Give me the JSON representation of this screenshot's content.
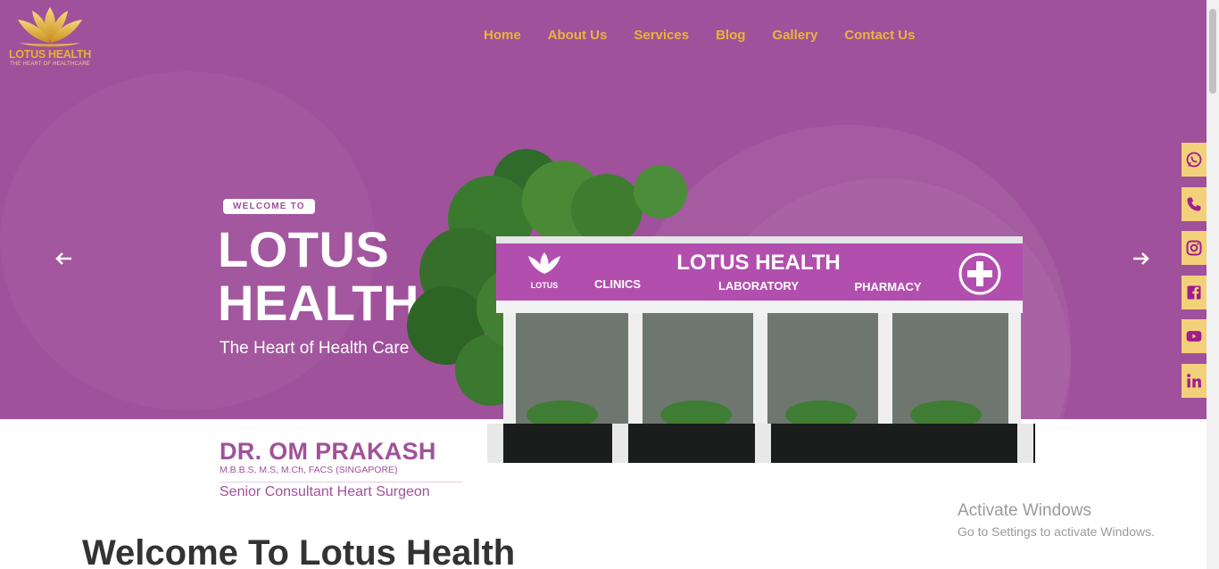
{
  "header": {
    "logo": {
      "brand": "LOTUS HEALTH",
      "tagline": "THE HEART OF HEALTHCARE"
    },
    "nav": [
      {
        "label": "Home"
      },
      {
        "label": "About Us"
      },
      {
        "label": "Services"
      },
      {
        "label": "Blog"
      },
      {
        "label": "Gallery"
      },
      {
        "label": "Contact Us"
      }
    ]
  },
  "hero": {
    "badge": "WELCOME TO",
    "title_line1": "LOTUS",
    "title_line2": "HEALTH",
    "subtitle": "The Heart of Health Care",
    "prev_icon": "arrow-left-icon",
    "next_icon": "arrow-right-icon",
    "building_sign": {
      "name": "LOTUS HEALTH",
      "logo_text": "LOTUS",
      "clinics": "CLINICS",
      "laboratory": "LABORATORY",
      "pharmacy": "PHARMACY"
    }
  },
  "doctor": {
    "name": "DR. OM PRAKASH",
    "qualifications": "M.B.B.S, M.S, M.Ch, FACS (SINGAPORE)",
    "role": "Senior Consultant Heart Surgeon"
  },
  "social": [
    {
      "icon": "whatsapp-icon"
    },
    {
      "icon": "phone-icon"
    },
    {
      "icon": "instagram-icon"
    },
    {
      "icon": "facebook-icon"
    },
    {
      "icon": "youtube-icon"
    },
    {
      "icon": "linkedin-icon"
    }
  ],
  "section": {
    "heading": "Welcome To Lotus Health"
  },
  "os_overlay": {
    "line1": "Activate Windows",
    "line2": "Go to Settings to activate Windows."
  },
  "colors": {
    "brand_purple": "#a0519b",
    "nav_gold": "#e9b43a",
    "social_bg": "#f3d17a",
    "social_icon": "#a01c8e"
  }
}
